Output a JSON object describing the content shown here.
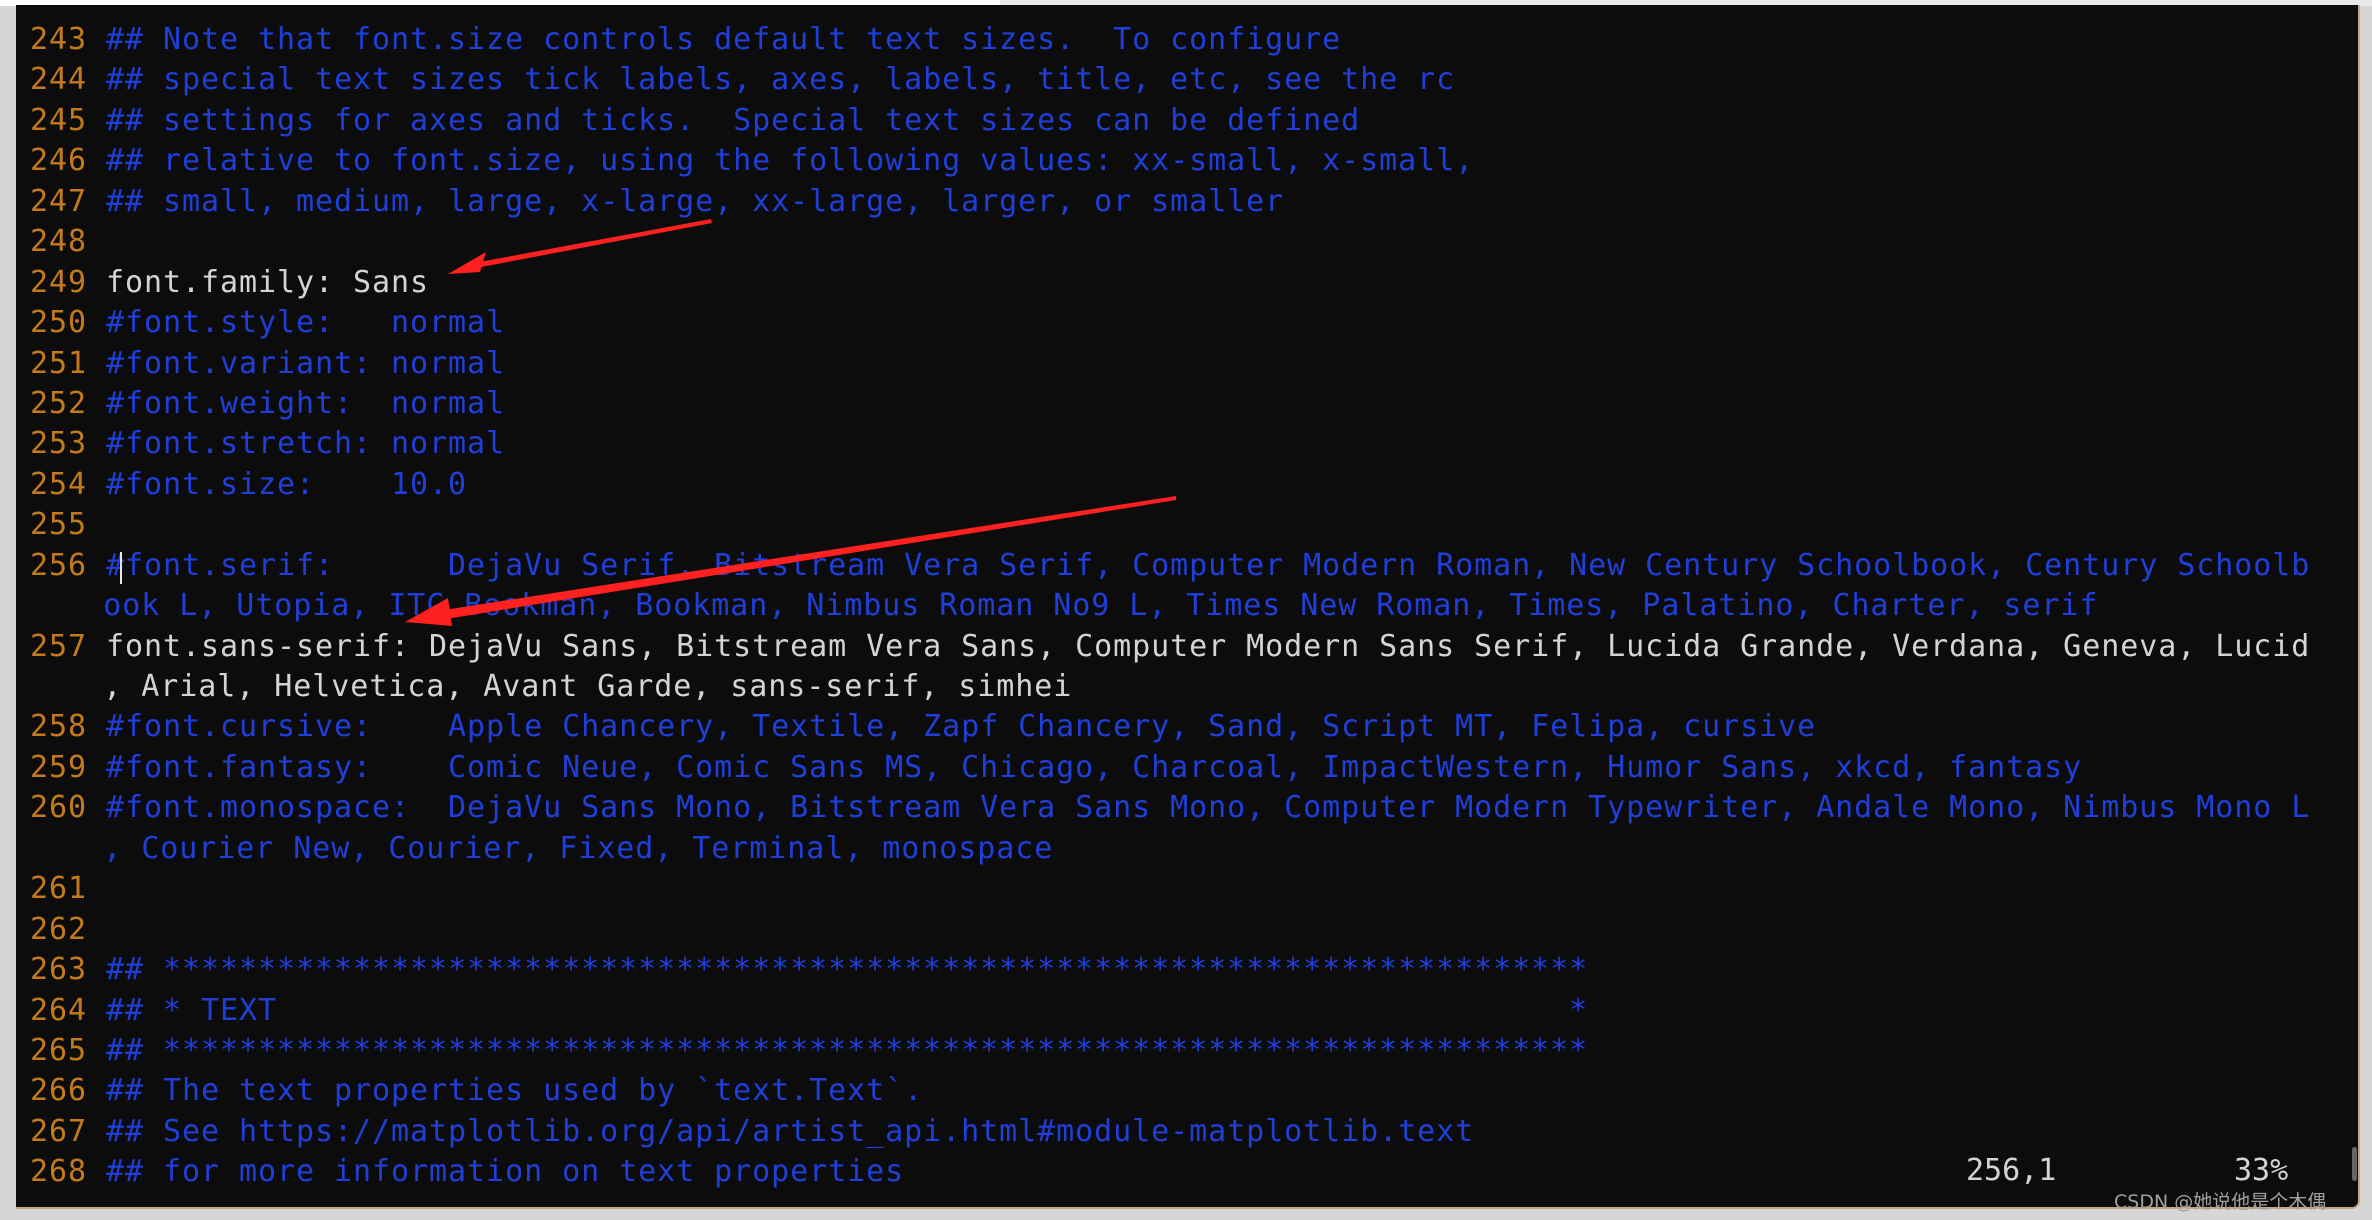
{
  "editor": {
    "rows": [
      {
        "num": "243",
        "text": "## Note that font.size controls default text sizes.  To configure",
        "style": "c"
      },
      {
        "num": "244",
        "text": "## special text sizes tick labels, axes, labels, title, etc, see the rc",
        "style": "c"
      },
      {
        "num": "245",
        "text": "## settings for axes and ticks.  Special text sizes can be defined",
        "style": "c"
      },
      {
        "num": "246",
        "text": "## relative to font.size, using the following values: xx-small, x-small,",
        "style": "c"
      },
      {
        "num": "247",
        "text": "## small, medium, large, x-large, xx-large, larger, or smaller",
        "style": "c"
      },
      {
        "num": "248",
        "text": "",
        "style": "c"
      },
      {
        "num": "249",
        "text": "font.family: Sans",
        "style": "t"
      },
      {
        "num": "250",
        "text": "#font.style:   normal",
        "style": "c"
      },
      {
        "num": "251",
        "text": "#font.variant: normal",
        "style": "c"
      },
      {
        "num": "252",
        "text": "#font.weight:  normal",
        "style": "c"
      },
      {
        "num": "253",
        "text": "#font.stretch: normal",
        "style": "c"
      },
      {
        "num": "254",
        "text": "#font.size:    10.0",
        "style": "c"
      },
      {
        "num": "255",
        "text": "",
        "style": "c"
      },
      {
        "num": "256",
        "text": "#font.serif:      DejaVu Serif, Bitstream Vera Serif, Computer Modern Roman, New Century Schoolbook, Century Schoolb",
        "style": "c"
      },
      {
        "num": "",
        "text": "ook L, Utopia, ITC Bookman, Bookman, Nimbus Roman No9 L, Times New Roman, Times, Palatino, Charter, serif",
        "style": "c"
      },
      {
        "num": "257",
        "text": "font.sans-serif: DejaVu Sans, Bitstream Vera Sans, Computer Modern Sans Serif, Lucida Grande, Verdana, Geneva, Lucid",
        "style": "t"
      },
      {
        "num": "",
        "text": ", Arial, Helvetica, Avant Garde, sans-serif, simhei",
        "style": "t"
      },
      {
        "num": "258",
        "text": "#font.cursive:    Apple Chancery, Textile, Zapf Chancery, Sand, Script MT, Felipa, cursive",
        "style": "c"
      },
      {
        "num": "259",
        "text": "#font.fantasy:    Comic Neue, Comic Sans MS, Chicago, Charcoal, ImpactWestern, Humor Sans, xkcd, fantasy",
        "style": "c"
      },
      {
        "num": "260",
        "text": "#font.monospace:  DejaVu Sans Mono, Bitstream Vera Sans Mono, Computer Modern Typewriter, Andale Mono, Nimbus Mono L",
        "style": "c"
      },
      {
        "num": "",
        "text": ", Courier New, Courier, Fixed, Terminal, monospace",
        "style": "c"
      },
      {
        "num": "261",
        "text": "",
        "style": "c"
      },
      {
        "num": "262",
        "text": "",
        "style": "c"
      },
      {
        "num": "263",
        "text": "## ***************************************************************************",
        "style": "c"
      },
      {
        "num": "264",
        "text": "## * TEXT                                                                    *",
        "style": "c"
      },
      {
        "num": "265",
        "text": "## ***************************************************************************",
        "style": "c"
      },
      {
        "num": "266",
        "text": "## The text properties used by `text.Text`.",
        "style": "c"
      },
      {
        "num": "267",
        "text": "## See https://matplotlib.org/api/artist_api.html#module-matplotlib.text",
        "style": "c"
      },
      {
        "num": "268",
        "text": "## for more information on text properties",
        "style": "c"
      }
    ]
  },
  "status": {
    "cursor_position": "256,1",
    "scroll_percent": "33%"
  },
  "watermark": "CSDN @她说他是个木偶",
  "colors": {
    "background": "#0c0c0c",
    "line_number": "#c47a1a",
    "comment": "#1f3fd8",
    "text": "#d4d4d4",
    "annotation_arrow": "#ff2020"
  }
}
